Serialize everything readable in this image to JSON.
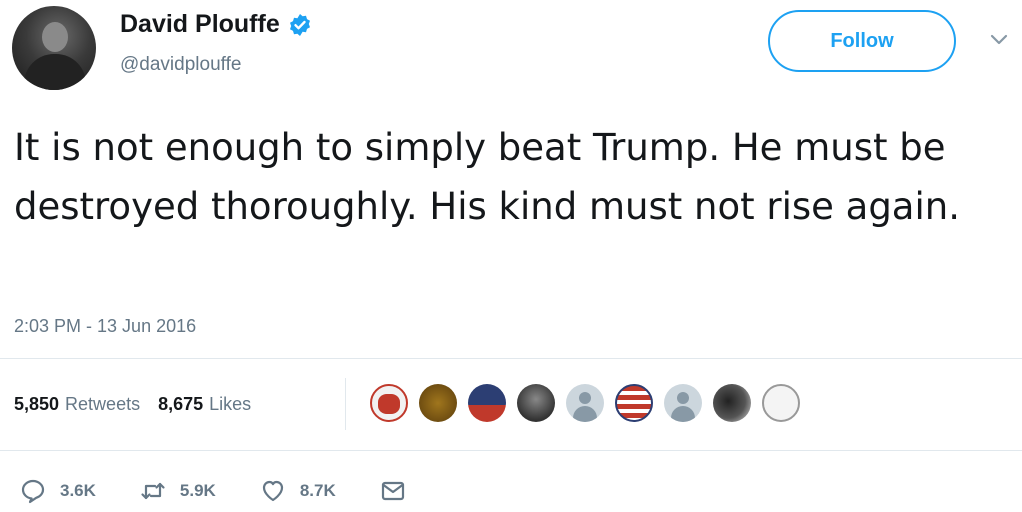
{
  "user": {
    "display_name": "David Plouffe",
    "handle": "@davidplouffe",
    "verified": true
  },
  "follow_label": "Follow",
  "tweet": {
    "text": "It is not enough to simply beat Trump. He must be destroyed thoroughly. His kind must not rise again.",
    "timestamp": "2:03 PM - 13 Jun 2016"
  },
  "stats": {
    "retweets_count": "5,850",
    "retweets_label": "Retweets",
    "likes_count": "8,675",
    "likes_label": "Likes"
  },
  "actions": {
    "reply_count": "3.6K",
    "retweet_count": "5.9K",
    "like_count": "8.7K"
  },
  "colors": {
    "accent": "#1da1f2",
    "secondary_text": "#657786",
    "primary_text": "#14171a"
  },
  "liker_avatars": [
    "red-cartoon-avatar",
    "lion-avatar",
    "person-avatar",
    "person-avatar",
    "default-avatar",
    "flag-avatar",
    "default-avatar",
    "person-avatar",
    "sketch-avatar"
  ]
}
